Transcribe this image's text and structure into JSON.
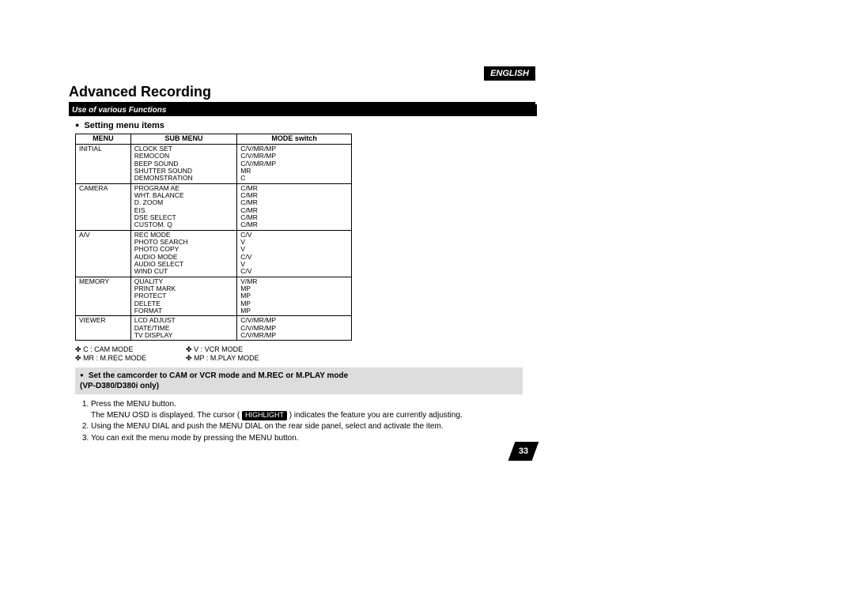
{
  "lang": "ENGLISH",
  "title": "Advanced Recording",
  "subtitle": "Use of various Functions",
  "section_head": "Setting menu items",
  "table": {
    "headers": [
      "MENU",
      "SUB MENU",
      "MODE switch"
    ],
    "rows": [
      {
        "menu": "INITIAL",
        "sub": [
          "CLOCK SET",
          "REMOCON",
          "BEEP SOUND",
          "SHUTTER SOUND",
          "DEMONSTRATION"
        ],
        "mode": [
          "C/V/MR/MP",
          "C/V/MR/MP",
          "C/V/MR/MP",
          "MR",
          "C"
        ]
      },
      {
        "menu": "CAMERA",
        "sub": [
          "PROGRAM AE",
          "WHT. BALANCE",
          "D. ZOOM",
          "EIS",
          "DSE SELECT",
          "CUSTOM. Q"
        ],
        "mode": [
          "C/MR",
          "C/MR",
          "C/MR",
          "C/MR",
          "C/MR",
          "C/MR"
        ]
      },
      {
        "menu": "A/V",
        "sub": [
          "REC MODE",
          "PHOTO SEARCH",
          "PHOTO COPY",
          "AUDIO MODE",
          "AUDIO SELECT",
          "WIND CUT"
        ],
        "mode": [
          "C/V",
          "V",
          "V",
          "C/V",
          "V",
          "C/V"
        ]
      },
      {
        "menu": "MEMORY",
        "sub": [
          "QUALITY",
          "PRINT MARK",
          "PROTECT",
          "DELETE",
          "FORMAT"
        ],
        "mode": [
          "V/MR",
          "MP",
          "MP",
          "MP",
          "MP"
        ]
      },
      {
        "menu": "VIEWER",
        "sub": [
          "LCD ADJUST",
          "DATE/TIME",
          "TV DISPLAY"
        ],
        "mode": [
          "C/V/MR/MP",
          "C/V/MR/MP",
          "C/V/MR/MP"
        ]
      }
    ]
  },
  "legend": {
    "c": "C : CAM MODE",
    "v": "V : VCR MODE",
    "mr": "MR : M.REC MODE",
    "mp": "MP : M.PLAY MODE"
  },
  "graybox": {
    "line1": "Set the camcorder to CAM or VCR mode and M.REC or M.PLAY mode",
    "line2": "(VP-D380/D380i only)"
  },
  "steps": {
    "s1a": "Press the MENU button.",
    "s1b_pre": "The MENU OSD is displayed. The cursor ( ",
    "s1b_hl": "HIGHLIGHT",
    "s1b_post": " ) indicates the feature you are currently adjusting.",
    "s2": "Using the MENU DIAL and push the MENU DIAL on the rear side panel, select and activate the item.",
    "s3": "You can exit the menu mode by pressing the MENU button."
  },
  "page_number": "33",
  "glyph": {
    "clover": "✤"
  }
}
